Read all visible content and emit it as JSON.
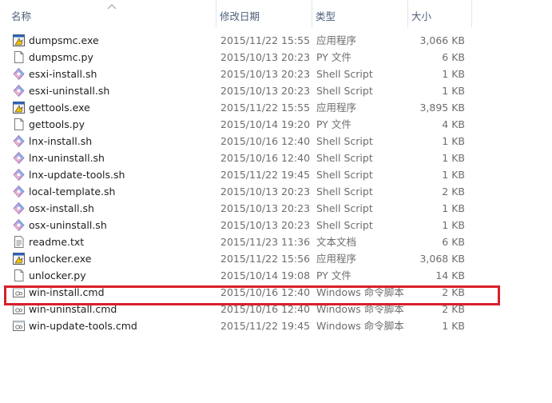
{
  "columns": {
    "name": "名称",
    "date": "修改日期",
    "type": "类型",
    "size": "大小"
  },
  "files": [
    {
      "name": "dumpsmc.exe",
      "date": "2015/11/22 15:55",
      "type": "应用程序",
      "size": "3,066 KB",
      "icon": "exe-icon"
    },
    {
      "name": "dumpsmc.py",
      "date": "2015/10/13 20:23",
      "type": "PY 文件",
      "size": "6 KB",
      "icon": "document-icon"
    },
    {
      "name": "esxi-install.sh",
      "date": "2015/10/13 20:23",
      "type": "Shell Script",
      "size": "1 KB",
      "icon": "shell-script-icon"
    },
    {
      "name": "esxi-uninstall.sh",
      "date": "2015/10/13 20:23",
      "type": "Shell Script",
      "size": "1 KB",
      "icon": "shell-script-icon"
    },
    {
      "name": "gettools.exe",
      "date": "2015/11/22 15:55",
      "type": "应用程序",
      "size": "3,895 KB",
      "icon": "exe-icon"
    },
    {
      "name": "gettools.py",
      "date": "2015/10/14 19:20",
      "type": "PY 文件",
      "size": "4 KB",
      "icon": "document-icon"
    },
    {
      "name": "lnx-install.sh",
      "date": "2015/10/16 12:40",
      "type": "Shell Script",
      "size": "1 KB",
      "icon": "shell-script-icon"
    },
    {
      "name": "lnx-uninstall.sh",
      "date": "2015/10/16 12:40",
      "type": "Shell Script",
      "size": "1 KB",
      "icon": "shell-script-icon"
    },
    {
      "name": "lnx-update-tools.sh",
      "date": "2015/11/22 19:45",
      "type": "Shell Script",
      "size": "1 KB",
      "icon": "shell-script-icon"
    },
    {
      "name": "local-template.sh",
      "date": "2015/10/13 20:23",
      "type": "Shell Script",
      "size": "2 KB",
      "icon": "shell-script-icon"
    },
    {
      "name": "osx-install.sh",
      "date": "2015/10/13 20:23",
      "type": "Shell Script",
      "size": "1 KB",
      "icon": "shell-script-icon"
    },
    {
      "name": "osx-uninstall.sh",
      "date": "2015/10/13 20:23",
      "type": "Shell Script",
      "size": "1 KB",
      "icon": "shell-script-icon"
    },
    {
      "name": "readme.txt",
      "date": "2015/11/23 11:36",
      "type": "文本文档",
      "size": "6 KB",
      "icon": "text-file-icon"
    },
    {
      "name": "unlocker.exe",
      "date": "2015/11/22 15:56",
      "type": "应用程序",
      "size": "3,068 KB",
      "icon": "exe-icon"
    },
    {
      "name": "unlocker.py",
      "date": "2015/10/14 19:08",
      "type": "PY 文件",
      "size": "14 KB",
      "icon": "document-icon"
    },
    {
      "name": "win-install.cmd",
      "date": "2015/10/16 12:40",
      "type": "Windows 命令脚本",
      "size": "2 KB",
      "icon": "cmd-script-icon"
    },
    {
      "name": "win-uninstall.cmd",
      "date": "2015/10/16 12:40",
      "type": "Windows 命令脚本",
      "size": "2 KB",
      "icon": "cmd-script-icon"
    },
    {
      "name": "win-update-tools.cmd",
      "date": "2015/11/22 19:45",
      "type": "Windows 命令脚本",
      "size": "1 KB",
      "icon": "cmd-script-icon"
    }
  ],
  "colors": {
    "highlight_border": "#d9202a",
    "header_text": "#4c607a"
  }
}
